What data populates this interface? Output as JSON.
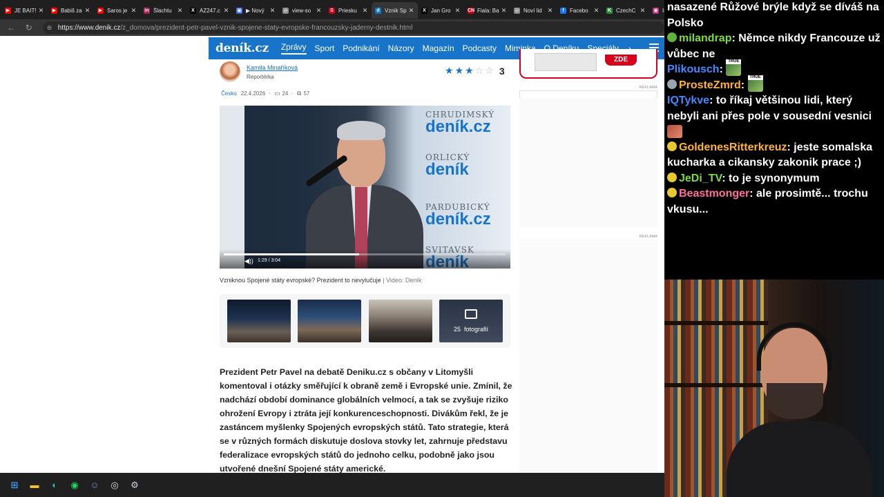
{
  "browser": {
    "tabs": [
      {
        "title": "JE BAIT!",
        "fav_color": "#ff0000",
        "fav_glyph": "▶"
      },
      {
        "title": "Babiš za",
        "fav_color": "#ff0000",
        "fav_glyph": "▶"
      },
      {
        "title": "Saros je",
        "fav_color": "#ff0000",
        "fav_glyph": "▶"
      },
      {
        "title": "Šlachtu",
        "fav_color": "#b02050",
        "fav_glyph": "in"
      },
      {
        "title": "AZ247.c",
        "fav_color": "#000000",
        "fav_glyph": "X"
      },
      {
        "title": "▶ Nový",
        "fav_color": "#3a6ee8",
        "fav_glyph": "▣"
      },
      {
        "title": "view-so",
        "fav_color": "#888888",
        "fav_glyph": "◎"
      },
      {
        "title": "Priesku",
        "fav_color": "#d6001c",
        "fav_glyph": "S"
      },
      {
        "title": "Vznik Sp",
        "fav_color": "#1874c9",
        "fav_glyph": "d",
        "active": true
      },
      {
        "title": "Jan Gro",
        "fav_color": "#000000",
        "fav_glyph": "X"
      },
      {
        "title": "Fiala: Ba",
        "fav_color": "#d6001c",
        "fav_glyph": "CN"
      },
      {
        "title": "Noví lid",
        "fav_color": "#888888",
        "fav_glyph": "◎"
      },
      {
        "title": "Facebo",
        "fav_color": "#1877f2",
        "fav_glyph": "f"
      },
      {
        "title": "CzechC",
        "fav_color": "#2e8b3e",
        "fav_glyph": "K"
      },
      {
        "title": "Ir",
        "fav_color": "#c13584",
        "fav_glyph": "◉"
      }
    ],
    "url_host": "https://www.denik.cz",
    "url_path": "/z_domova/prezident-petr-pavel-vznik-spojene-staty-evropske-francouzsky-jaderny-destnik.html"
  },
  "site": {
    "logo": "deník.cz",
    "nav": [
      "Zprávy",
      "Sport",
      "Podnikání",
      "Názory",
      "Magazín",
      "Podcasty",
      "Miminka",
      "O Deníku",
      "Speciály"
    ],
    "nav_active": 0,
    "brand_color": "#1874c9"
  },
  "article": {
    "author_name": "Kamila Minaříková",
    "author_role": "Reportérka",
    "rating_value": 3,
    "rating_max": 5,
    "rating_count": "3",
    "category": "Česko",
    "date": "22.4.2026",
    "comments": "24",
    "shares": "57",
    "video_time": "1:29 / 3:04",
    "video_progress": 0.48,
    "video_brands": [
      {
        "small": "CHRUDIMSKÝ",
        "big": "deník.cz"
      },
      {
        "small": "ORLICKÝ",
        "big": "deník"
      },
      {
        "small": "PARDUBICKÝ",
        "big": "deník.cz"
      },
      {
        "small": "SVITAVSK",
        "big": "deník"
      }
    ],
    "caption": "Vzniknou Spojené státy evropské? Prezident to nevylučuje",
    "caption_src": "| Video: Deník",
    "gallery_count": "25",
    "gallery_label": "fotografií",
    "lead": "Prezident Petr Pavel na debatě Deniku.cz s občany v Litomyšli komentoval i otázky směřující k obraně země i Evropské unie. Zmínil, že nadchází období dominance globálních velmocí, a tak se zvyšuje riziko ohrožení Evropy i ztráta její konkurenceschopnosti. Divákům řekl, že je zastáncem myšlenky Spojených evropských států. Tato strategie, která se v různých formách diskutuje doslova stovky let, zahrnuje představu federalizace evropských států do jednoho celku, podobně jako jsou utvořené dnešní Spojené státy americké."
  },
  "ads": {
    "label": "REKLAMA",
    "cta": "ZDE"
  },
  "chat": [
    {
      "user": "",
      "text": "nasazené Růžové brýle když se díváš na Polsko",
      "color": "#ffffff",
      "badge": ""
    },
    {
      "user": "milandrap",
      "text": "Němce nikdy Francouze už vůbec ne",
      "color": "#7ddc3f",
      "badge": "#5fb33a"
    },
    {
      "user": "Plikousch",
      "text": "",
      "color": "#3f8bff",
      "badge": "",
      "emote": "TRUE"
    },
    {
      "user": "ProsteZmrd",
      "text": "",
      "color": "#ffb238",
      "badge": "#9aa5b0",
      "emote": "TRUE"
    },
    {
      "user": "IQTykve",
      "text": "to říkaj většinou lidi, který nebyli ani přes pole v sousední vesnici",
      "color": "#3f8bff",
      "badge": "",
      "emote_face": true
    },
    {
      "user": "GoldenesRitterkreuz",
      "text": "jeste somalska kucharka a cikansky zakonik prace ;)",
      "color": "#ffb238",
      "badge": "#e8c830"
    },
    {
      "user": "JeDi_TV",
      "text": "to je synonymum",
      "color": "#7ddc3f",
      "badge": "#e8c830"
    },
    {
      "user": "Beastmonger",
      "text": "ale prosimtě... trochu vkusu...",
      "color": "#ff6f9c",
      "badge": "#e8c830"
    }
  ],
  "taskbar": [
    {
      "name": "windows-start-icon",
      "glyph": "⊞",
      "color": "#3aa0ff"
    },
    {
      "name": "file-explorer-icon",
      "glyph": "▬",
      "color": "#f2c230"
    },
    {
      "name": "edge-browser-icon",
      "glyph": "◐",
      "color": "#2fb4c9"
    },
    {
      "name": "spotify-icon",
      "glyph": "◉",
      "color": "#1ed760"
    },
    {
      "name": "discord-icon",
      "glyph": "☺",
      "color": "#7289da"
    },
    {
      "name": "obs-icon",
      "glyph": "◎",
      "color": "#dddddd"
    },
    {
      "name": "steam-icon",
      "glyph": "⚙",
      "color": "#c7d5e0"
    }
  ]
}
